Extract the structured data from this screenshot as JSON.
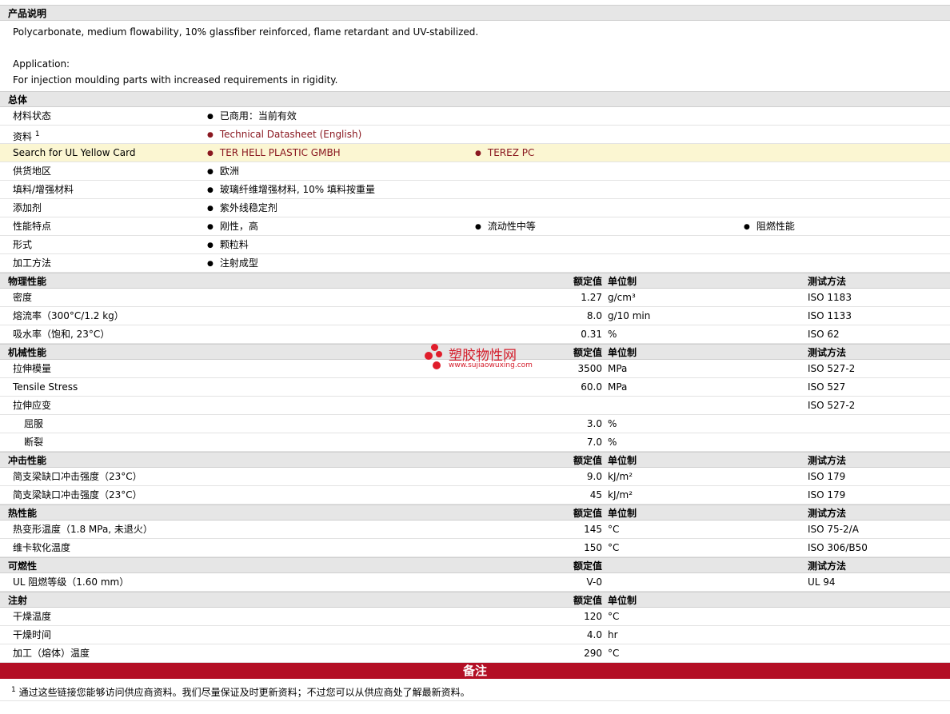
{
  "description": {
    "title": "产品说明",
    "line1": "Polycarbonate, medium flowability, 10% glassfiber reinforced, flame retardant and UV-stabilized.",
    "line2": "Application:",
    "line3": "For injection moulding parts with increased requirements in rigidity."
  },
  "general": {
    "title": "总体",
    "status_label": "材料状态",
    "status_value": "已商用：当前有效",
    "source_label": "资料",
    "source_sup": "1",
    "source_link": "Technical Datasheet (English)",
    "ul_label": "Search for UL Yellow Card",
    "ul_link1": "TER HELL PLASTIC GMBH",
    "ul_link2": "TEREZ PC",
    "region_label": "供货地区",
    "region_value": "欧洲",
    "filler_label": "填料/增强材料",
    "filler_value": "玻璃纤维增强材料, 10% 填料按重量",
    "additive_label": "添加剂",
    "additive_value": "紫外线稳定剂",
    "feature_label": "性能特点",
    "feature1": "刚性，高",
    "feature2": "流动性中等",
    "feature3": "阻燃性能",
    "form_label": "形式",
    "form_value": "颗粒料",
    "process_label": "加工方法",
    "process_value": "注射成型"
  },
  "headers": {
    "value": "额定值",
    "unit": "单位制",
    "test": "测试方法"
  },
  "physical": {
    "title": "物理性能",
    "rows": [
      {
        "label": "密度",
        "value": "1.27",
        "unit": "g/cm³",
        "test": "ISO 1183"
      },
      {
        "label": "熔流率（300°C/1.2 kg）",
        "value": "8.0",
        "unit": "g/10 min",
        "test": "ISO 1133"
      },
      {
        "label": "吸水率（饱和, 23°C）",
        "value": "0.31",
        "unit": "%",
        "test": "ISO 62"
      }
    ]
  },
  "mechanical": {
    "title": "机械性能",
    "rows": [
      {
        "label": "拉伸模量",
        "value": "3500",
        "unit": "MPa",
        "test": "ISO 527-2"
      },
      {
        "label": "Tensile Stress",
        "value": "60.0",
        "unit": "MPa",
        "test": "ISO 527"
      },
      {
        "label": "拉伸应变",
        "value": "",
        "unit": "",
        "test": "ISO 527-2"
      },
      {
        "label": "屈服",
        "value": "3.0",
        "unit": "%",
        "test": ""
      },
      {
        "label": "断裂",
        "value": "7.0",
        "unit": "%",
        "test": ""
      }
    ]
  },
  "impact": {
    "title": "冲击性能",
    "rows": [
      {
        "label": "简支梁缺口冲击强度（23°C）",
        "value": "9.0",
        "unit": "kJ/m²",
        "test": "ISO 179"
      },
      {
        "label": "简支梁缺口冲击强度（23°C）",
        "value": "45",
        "unit": "kJ/m²",
        "test": "ISO 179"
      }
    ]
  },
  "thermal": {
    "title": "热性能",
    "rows": [
      {
        "label": "热变形温度（1.8 MPa, 未退火）",
        "value": "145",
        "unit": "°C",
        "test": "ISO 75-2/A"
      },
      {
        "label": "维卡软化温度",
        "value": "150",
        "unit": "°C",
        "test": "ISO 306/B50"
      }
    ]
  },
  "flammability": {
    "title": "可燃性",
    "rows": [
      {
        "label": "UL 阻燃等级（1.60 mm）",
        "value": "V-0",
        "test": "UL 94"
      }
    ]
  },
  "injection": {
    "title": "注射",
    "rows": [
      {
        "label": "干燥温度",
        "value": "120",
        "unit": "°C"
      },
      {
        "label": "干燥时间",
        "value": "4.0",
        "unit": "hr"
      },
      {
        "label": "加工（熔体）温度",
        "value": "290",
        "unit": "°C"
      }
    ]
  },
  "notes": {
    "title": "备注",
    "sup": "1",
    "text": "通过这些链接您能够访问供应商资料。我们尽量保证及时更新资料；不过您可以从供应商处了解最新资料。"
  },
  "watermark": {
    "name": "塑胶物性网",
    "url": "www.sujiaowuxing.com"
  },
  "colors": {
    "notes_bar": "#b30f25",
    "link": "#8a1820",
    "highlight_row": "#fbf6d2"
  }
}
